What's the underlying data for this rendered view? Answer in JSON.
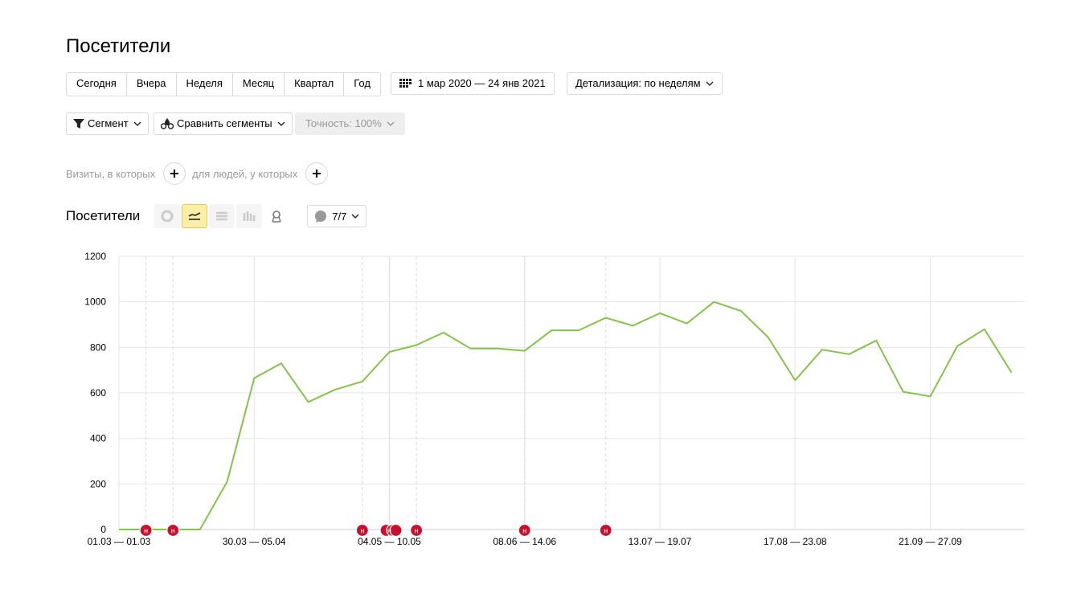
{
  "page_title": "Посетители",
  "periods": [
    "Сегодня",
    "Вчера",
    "Неделя",
    "Месяц",
    "Квартал",
    "Год"
  ],
  "date_range": "1 мар 2020 — 24 янв 2021",
  "detail": "Детализация: по неделям",
  "segment": "Сегмент",
  "compare": "Сравнить сегменты",
  "accuracy": "Точность: 100%",
  "filter_visits": "Визиты, в которых",
  "filter_people": "для людей, у которых",
  "chart_section_title": "Посетители",
  "notes_count": "7/7",
  "colors": {
    "line": "#85c24b",
    "marker": "#c8102e",
    "active_view": "#fdefa8"
  },
  "icons": [
    "calendar-icon",
    "funnel-icon",
    "drops-icon",
    "chevron-down-icon",
    "plus-icon",
    "pie-chart-icon",
    "line-chart-icon",
    "area-chart-icon",
    "bar-chart-icon",
    "map-icon",
    "comment-icon"
  ],
  "chart_data": {
    "type": "line",
    "x_labels": [
      "01.03 — 01.03",
      "30.03 — 05.04",
      "04.05 — 10.05",
      "08.06 — 14.06",
      "13.07 — 19.07",
      "17.08 — 23.08",
      "21.09 — 27.09"
    ],
    "x_label_index": [
      0,
      5,
      10,
      15,
      20,
      25,
      30
    ],
    "values": [
      0,
      0,
      0,
      0,
      210,
      665,
      730,
      560,
      615,
      650,
      780,
      810,
      865,
      795,
      795,
      785,
      875,
      875,
      930,
      895,
      950,
      905,
      1000,
      960,
      845,
      655,
      790,
      770,
      830,
      605,
      585,
      805,
      880,
      690
    ],
    "ylim": [
      0,
      1200
    ],
    "yticks": [
      0,
      200,
      400,
      600,
      800,
      1000,
      1200
    ],
    "grid": true,
    "note_marker_label": "н",
    "note_weeks": [
      1,
      2,
      9,
      10,
      11,
      15,
      18
    ]
  }
}
